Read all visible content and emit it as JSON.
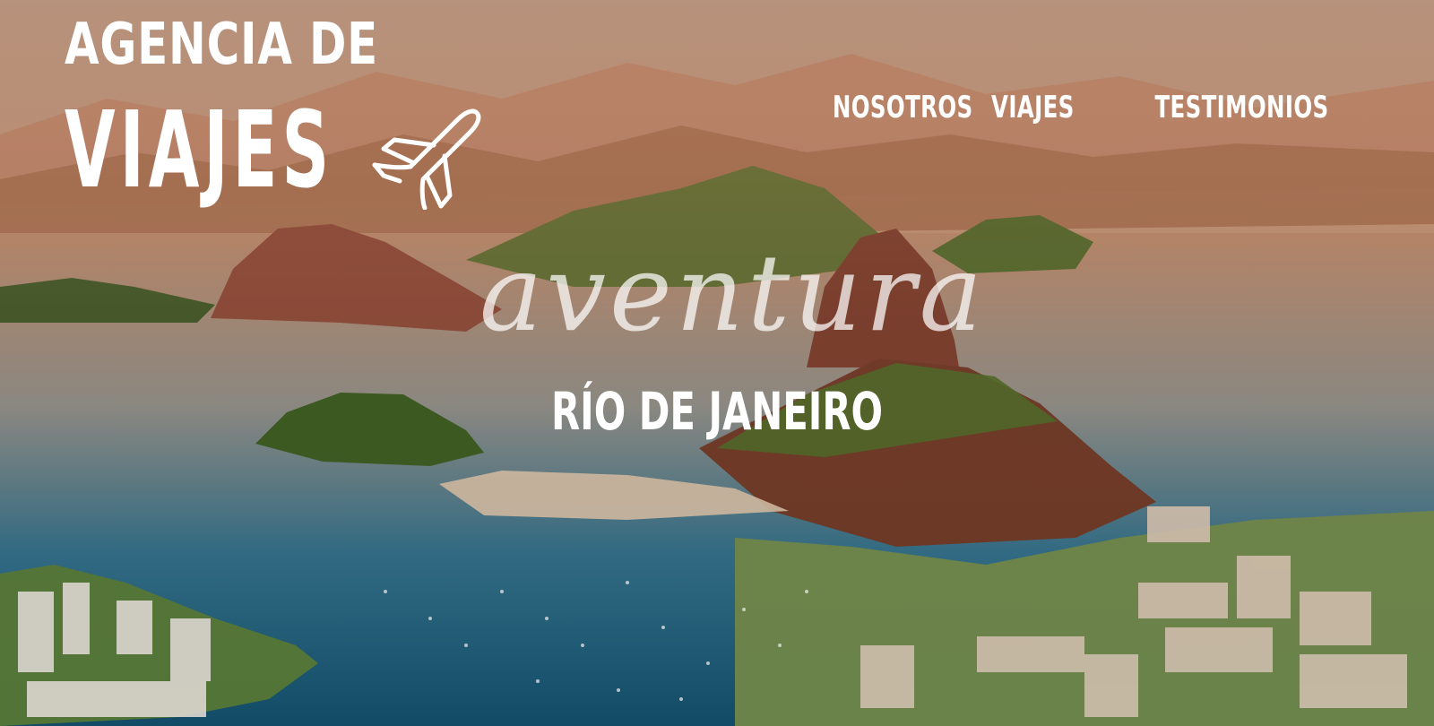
{
  "logo": {
    "line1": "AGENCIA DE",
    "line2": "VIAJES",
    "icon": "airplane-icon"
  },
  "nav": {
    "items": [
      {
        "label": "NOSOTROS"
      },
      {
        "label": "VIAJES"
      },
      {
        "label": "TESTIMONIOS"
      }
    ]
  },
  "hero": {
    "script_word": "aventura",
    "city": "RÍO DE JANEIRO",
    "background": "rio-de-janeiro-bay-photo"
  },
  "colors": {
    "text": "#ffffff",
    "sky": "#c98b5c",
    "sea": "#1f5f7d",
    "hills": "#4b6b2a"
  }
}
